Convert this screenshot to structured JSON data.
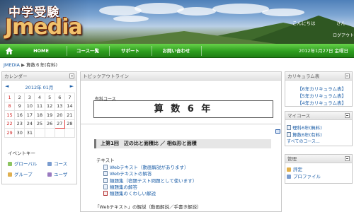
{
  "header": {
    "logo_jp": "中学受験",
    "logo_en": "Jmedia",
    "greeting": "こんにちは",
    "user_suffix": "さん",
    "logout": "ログアウト"
  },
  "nav": {
    "home": "HOME",
    "items": [
      "コース一覧",
      "サポート",
      "お問い合わせ"
    ],
    "date": "2012年1月27日 金曜日"
  },
  "breadcrumb": {
    "root": "JMEDIA",
    "current": "算数６年(有料)"
  },
  "calendar_block": {
    "title": "カレンダー",
    "month_label": "2012年 01月",
    "prev": "◄",
    "next": "►",
    "weeks": [
      [
        "1",
        "2",
        "3",
        "4",
        "5",
        "6",
        "7"
      ],
      [
        "8",
        "9",
        "10",
        "11",
        "12",
        "13",
        "14"
      ],
      [
        "15",
        "16",
        "17",
        "18",
        "19",
        "20",
        "21"
      ],
      [
        "22",
        "23",
        "24",
        "25",
        "26",
        "27",
        "28"
      ],
      [
        "29",
        "30",
        "31",
        "",
        "",
        "",
        ""
      ]
    ],
    "today": "27",
    "event_key_title": "イベントキー",
    "event_keys": [
      "グローバル",
      "コース",
      "グループ",
      "ユーザ"
    ]
  },
  "topic_block": {
    "title": "トピックアウトライン",
    "course_label": "有料コース",
    "course_name": "算 数 6 年",
    "lesson_title": "上第1回　辺の比と面積比 ／ 相似形と面積",
    "text_label": "テキスト",
    "resources": [
      "Webテキスト（動画解説があります）",
      "Webテキストの解答",
      "類題集（宿題テスト問題として使います）",
      "類題集の解答",
      "類題集のくわしい解説"
    ],
    "web_heading": "「Webテキスト」の解説（動画解説／手書き解説）"
  },
  "curriculum_block": {
    "title": "カリキュラム表",
    "links": [
      "【6年カリキュラム表】",
      "【5年カリキュラム表】",
      "【4年カリキュラム表】"
    ]
  },
  "mycourse_block": {
    "title": "マイコース",
    "courses": [
      "理科6年(無料)",
      "算数6年(有料)"
    ],
    "all_courses": "すべてのコース..."
  },
  "admin_block": {
    "title": "管理",
    "items": [
      "評定",
      "プロファイル"
    ]
  },
  "colors": {
    "nav_green": "#2e9e1f",
    "link_blue": "#1d5fa8",
    "sunday_red": "#d02020"
  }
}
